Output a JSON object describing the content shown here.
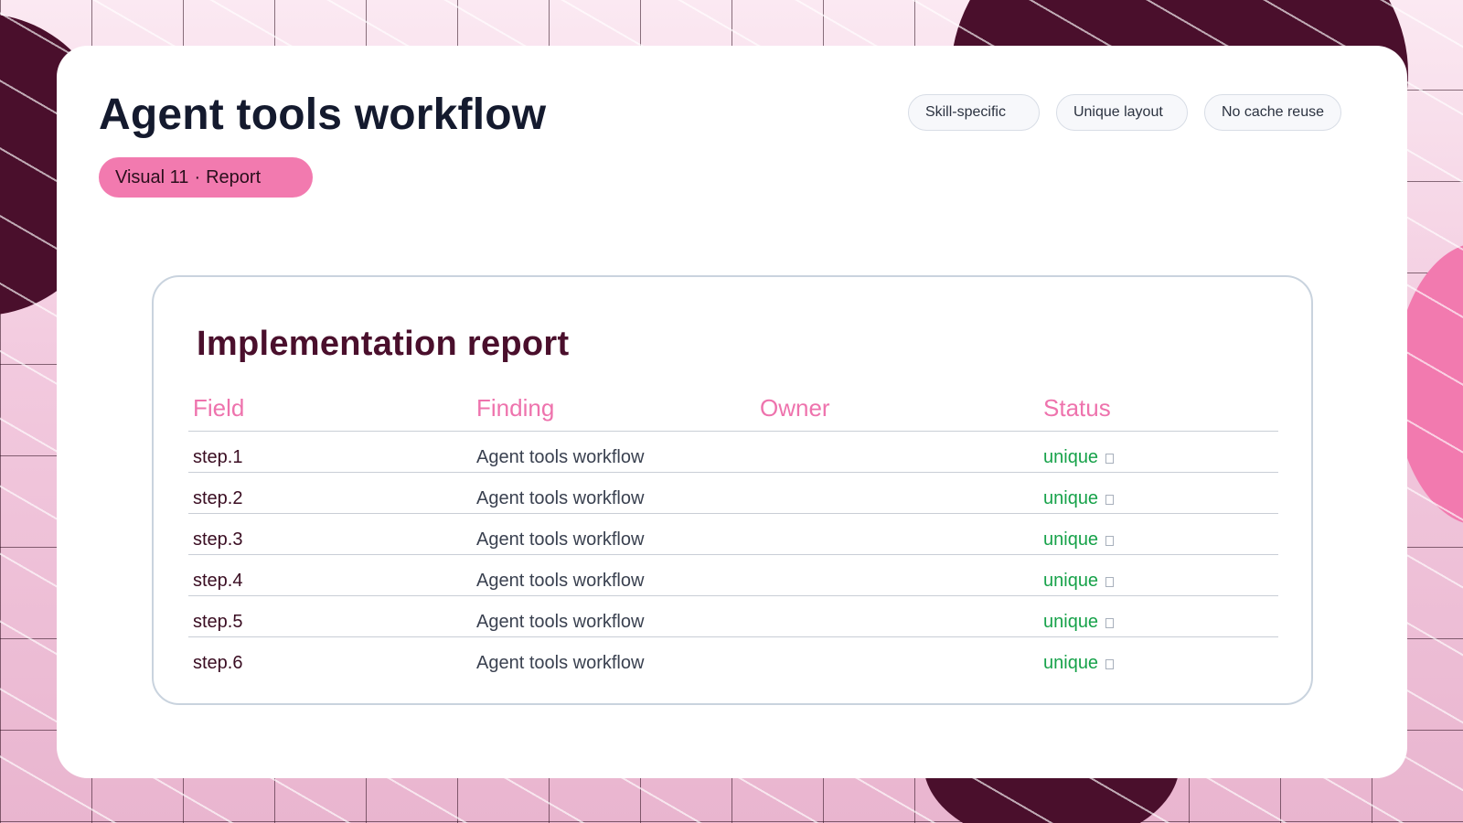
{
  "header": {
    "title": "Agent tools workflow",
    "badge": {
      "label": "Visual 11",
      "separator": "·",
      "type": "Report"
    },
    "tags": [
      "Skill-specific",
      "Unique layout",
      "No cache reuse"
    ]
  },
  "report": {
    "title": "Implementation report",
    "columns": [
      "Field",
      "Finding",
      "Owner",
      "Status"
    ],
    "rows": [
      {
        "field": "step.1",
        "finding": "Agent tools workflow",
        "owner": "",
        "status": "unique"
      },
      {
        "field": "step.2",
        "finding": "Agent tools workflow",
        "owner": "",
        "status": "unique"
      },
      {
        "field": "step.3",
        "finding": "Agent tools workflow",
        "owner": "",
        "status": "unique"
      },
      {
        "field": "step.4",
        "finding": "Agent tools workflow",
        "owner": "",
        "status": "unique"
      },
      {
        "field": "step.5",
        "finding": "Agent tools workflow",
        "owner": "",
        "status": "unique"
      },
      {
        "field": "step.6",
        "finding": "Agent tools workflow",
        "owner": "",
        "status": "unique"
      }
    ]
  },
  "colors": {
    "accent": "#f27aaf",
    "header_text": "#ee73ad",
    "status_ok": "#17a24a",
    "dark_plum": "#4a0f2c"
  },
  "icons": {
    "status_marker": "square-outline-icon"
  }
}
